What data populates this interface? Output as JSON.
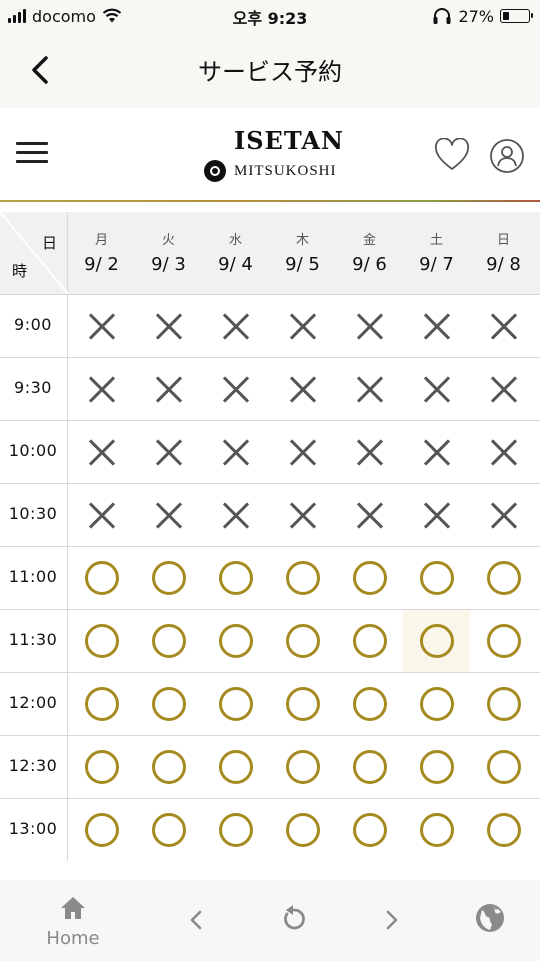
{
  "status_bar": {
    "carrier": "docomo",
    "time": "오후 9:23",
    "battery_text": "27%",
    "battery_level": 0.27
  },
  "nav": {
    "title": "サービス予約",
    "back_icon": "chevron-left-icon"
  },
  "brand": {
    "logo_top": "ISETAN",
    "logo_bottom": "MITSUKOSHI",
    "icons": [
      "menu-icon",
      "heart-icon",
      "account-icon"
    ],
    "line_colors": [
      "#b7a24a",
      "#b48d3f",
      "#8e9b45",
      "#b15742"
    ]
  },
  "calendar": {
    "corner_day": "日",
    "corner_time": "時",
    "days": [
      {
        "weekday": "月",
        "date": "9/ 2"
      },
      {
        "weekday": "火",
        "date": "9/ 3"
      },
      {
        "weekday": "水",
        "date": "9/ 4"
      },
      {
        "weekday": "木",
        "date": "9/ 5"
      },
      {
        "weekday": "金",
        "date": "9/ 6"
      },
      {
        "weekday": "土",
        "date": "9/ 7"
      },
      {
        "weekday": "日",
        "date": "9/ 8"
      }
    ],
    "legend": {
      "x": "unavailable",
      "o": "available"
    },
    "slots": [
      {
        "time": "9:00",
        "marks": [
          "x",
          "x",
          "x",
          "x",
          "x",
          "x",
          "x"
        ]
      },
      {
        "time": "9:30",
        "marks": [
          "x",
          "x",
          "x",
          "x",
          "x",
          "x",
          "x"
        ]
      },
      {
        "time": "10:00",
        "marks": [
          "x",
          "x",
          "x",
          "x",
          "x",
          "x",
          "x"
        ]
      },
      {
        "time": "10:30",
        "marks": [
          "x",
          "x",
          "x",
          "x",
          "x",
          "x",
          "x"
        ]
      },
      {
        "time": "11:00",
        "marks": [
          "o",
          "o",
          "o",
          "o",
          "o",
          "o",
          "o"
        ]
      },
      {
        "time": "11:30",
        "marks": [
          "o",
          "o",
          "o",
          "o",
          "o",
          "o",
          "o"
        ],
        "highlight_index": 5
      },
      {
        "time": "12:00",
        "marks": [
          "o",
          "o",
          "o",
          "o",
          "o",
          "o",
          "o"
        ]
      },
      {
        "time": "12:30",
        "marks": [
          "o",
          "o",
          "o",
          "o",
          "o",
          "o",
          "o"
        ]
      },
      {
        "time": "13:00",
        "marks": [
          "o",
          "o",
          "o",
          "o",
          "o",
          "o",
          "o"
        ]
      }
    ],
    "colors": {
      "available": "#a58a20",
      "unavailable": "#555555",
      "highlight": "#faf6ea"
    }
  },
  "toolbar": {
    "home_label": "Home",
    "icons": [
      "home-icon",
      "back-arrow-icon",
      "reload-icon",
      "forward-arrow-icon",
      "globe-icon"
    ]
  }
}
